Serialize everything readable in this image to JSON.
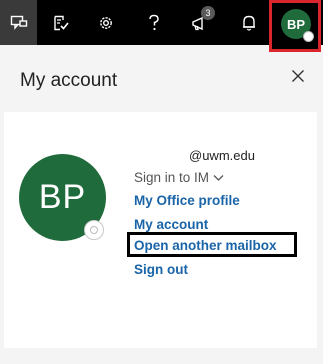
{
  "topbar": {
    "icons": [
      "feedback-icon",
      "checklist-icon",
      "gear-icon",
      "help-icon",
      "megaphone-icon",
      "bell-icon"
    ],
    "notification_badge": "3",
    "avatar_initials": "BP"
  },
  "panel": {
    "title": "My account",
    "close_icon": "close-icon"
  },
  "account": {
    "initials": "BP",
    "email": "@uwm.edu",
    "sign_in_label": "Sign in to IM",
    "links": {
      "office_profile": "My Office profile",
      "my_account": "My account",
      "open_mailbox": "Open another mailbox",
      "sign_out": "Sign out"
    }
  },
  "colors": {
    "avatar": "#1f6b3b",
    "link": "#1a64a8",
    "highlight_red": "#d9262c"
  }
}
